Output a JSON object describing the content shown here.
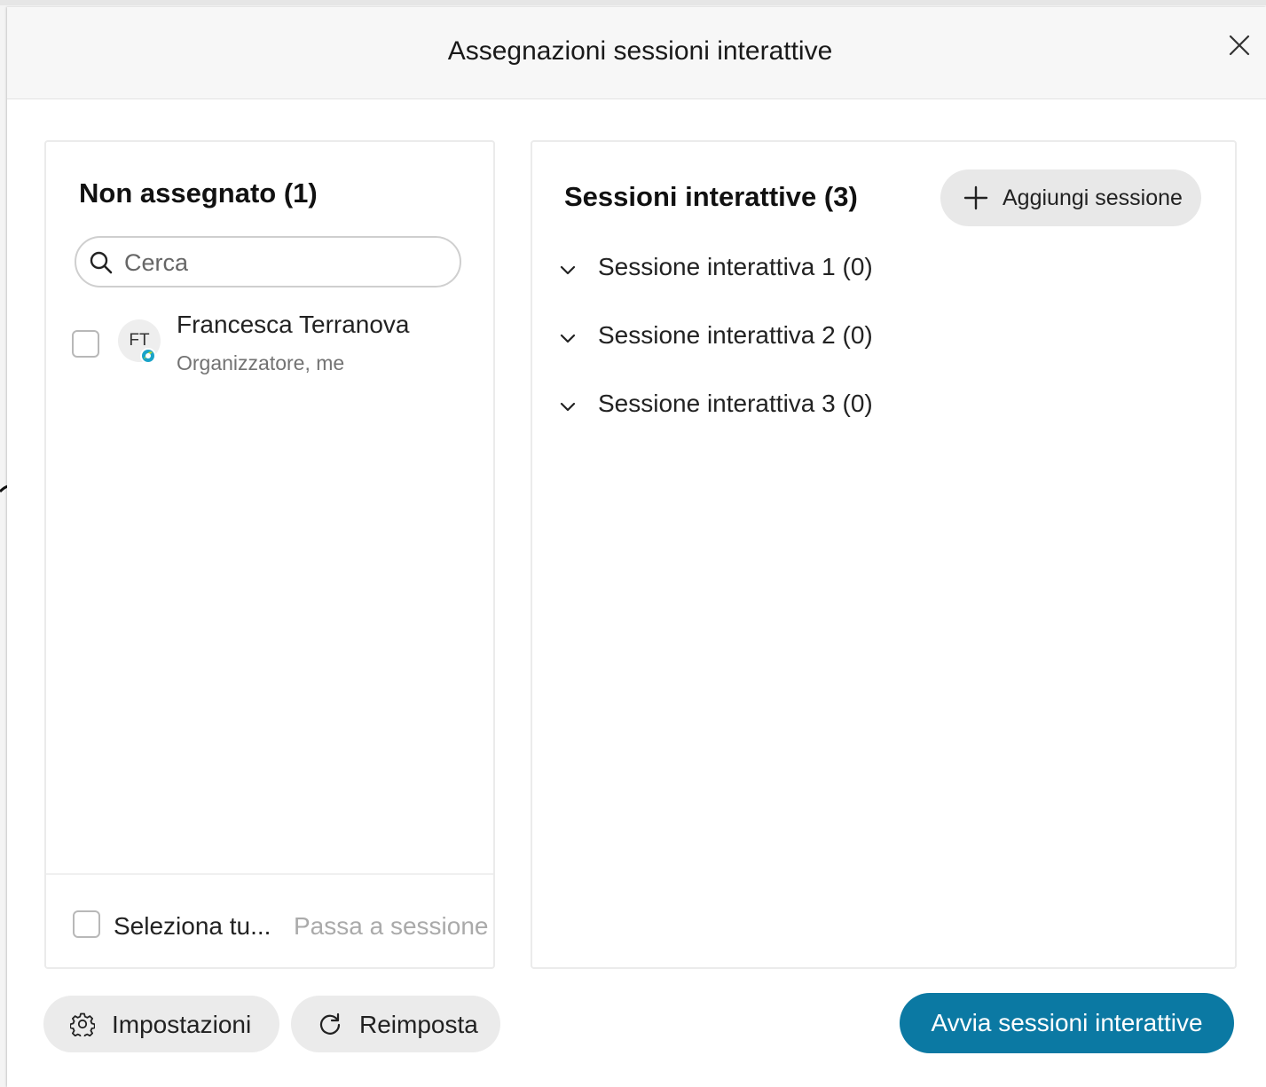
{
  "dialog": {
    "title": "Assegnazioni sessioni interattive"
  },
  "unassigned": {
    "title": "Non assegnato (1)",
    "search_placeholder": "Cerca",
    "participants": [
      {
        "initials": "FT",
        "name": "Francesca Terranova",
        "role": "Organizzatore, me"
      }
    ],
    "select_all_label": "Seleziona tu...",
    "move_to_session_label": "Passa a sessione"
  },
  "sessions": {
    "title": "Sessioni interattive (3)",
    "add_label": "Aggiungi sessione",
    "items": [
      {
        "label": "Sessione interattiva 1 (0)"
      },
      {
        "label": "Sessione interattiva 2 (0)"
      },
      {
        "label": "Sessione interattiva 3 (0)"
      }
    ]
  },
  "footer": {
    "settings_label": "Impostazioni",
    "reset_label": "Reimposta",
    "start_label": "Avvia sessioni interattive"
  },
  "colors": {
    "primary": "#0b79a3",
    "presence_badge": "#1aa3c8"
  }
}
